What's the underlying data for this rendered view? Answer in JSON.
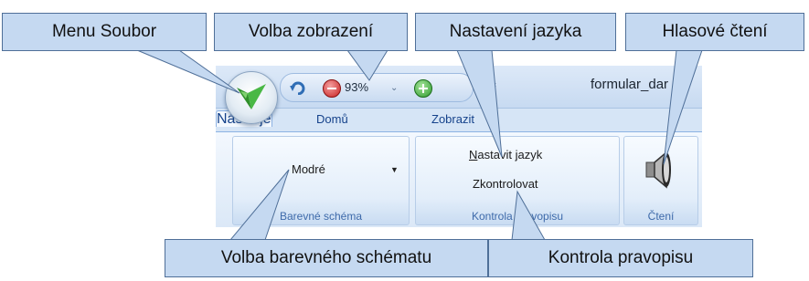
{
  "app": {
    "document_title": "formular_dar",
    "quick_access": {
      "zoom_value": "93%",
      "customize_glyph": "="
    },
    "tabs": [
      {
        "label": "Domů"
      },
      {
        "label": "Zobrazit"
      },
      {
        "label": "Nástroje",
        "active": true
      }
    ],
    "groups": {
      "color_scheme": {
        "label": "Barevné schéma",
        "selected": "Modré"
      },
      "spelling": {
        "label": "Kontrola pravopisu",
        "set_language_mnemonic": "N",
        "set_language_rest": "astavit jazyk",
        "check_label": "Zkontrolovat"
      },
      "reading": {
        "label": "Čtení"
      }
    }
  },
  "callouts": {
    "menu": "Menu Soubor",
    "view": "Volba zobrazení",
    "language": "Nastavení jazyka",
    "voice": "Hlasové čtení",
    "scheme": "Volba barevného schématu",
    "spelling": "Kontrola pravopisu"
  },
  "colors": {
    "callout_fill": "#c5d9f1",
    "ribbon_blue": "#15428b",
    "logo_green": "#3aa035"
  }
}
